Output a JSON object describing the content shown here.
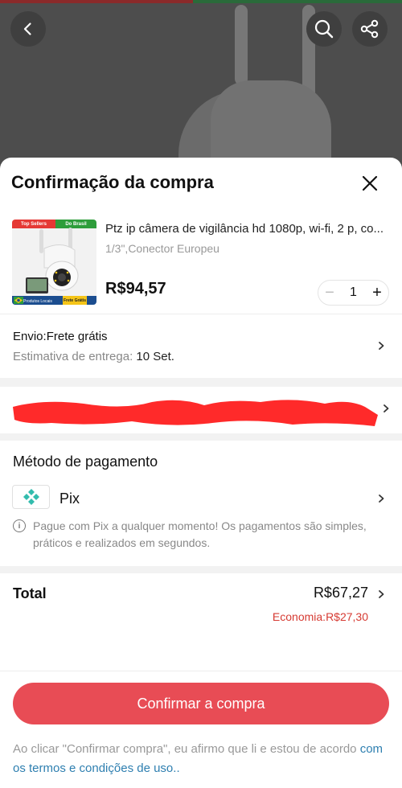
{
  "header": {
    "back_icon": "chevron-left-icon",
    "search_icon": "search-icon",
    "share_icon": "share-icon"
  },
  "sheet": {
    "title": "Confirmação da compra",
    "close_icon": "close-icon"
  },
  "product": {
    "thumbnail_tags": {
      "top_left": "Top Sellers",
      "top_right": "Do Brasil",
      "bottom_left": "Produtos Locais",
      "bottom_right": "Frete Grátis"
    },
    "title": "Ptz ip câmera de vigilância hd 1080p, wi-fi, 2 p, co...",
    "variant": "1/3\",Conector Europeu",
    "price": "R$94,57",
    "quantity": "1",
    "minus_label": "−",
    "plus_label": "+"
  },
  "shipping": {
    "title": "Envio:Frete grátis",
    "estimate_label": "Estimativa de entrega: ",
    "estimate_date": "10 Set."
  },
  "payment": {
    "section_title": "Método de pagamento",
    "method": "Pix",
    "note": "Pague com Pix a qualquer momento! Os pagamentos são simples, práticos e realizados em segundos.",
    "info_symbol": "i"
  },
  "summary": {
    "total_label": "Total",
    "total_value": "R$67,27",
    "savings": "Economia:R$27,30"
  },
  "actions": {
    "confirm_label": "Confirmar a compra"
  },
  "terms": {
    "text": "Ao clicar \"Confirmar compra\", eu afirmo que li e estou de acordo ",
    "link": "com os termos e condições de uso.."
  },
  "colors": {
    "accent": "#e84c55",
    "savings": "#d63a32",
    "link": "#2e7fb0",
    "pix": "#32bcad",
    "redaction": "#ff2a2a"
  }
}
